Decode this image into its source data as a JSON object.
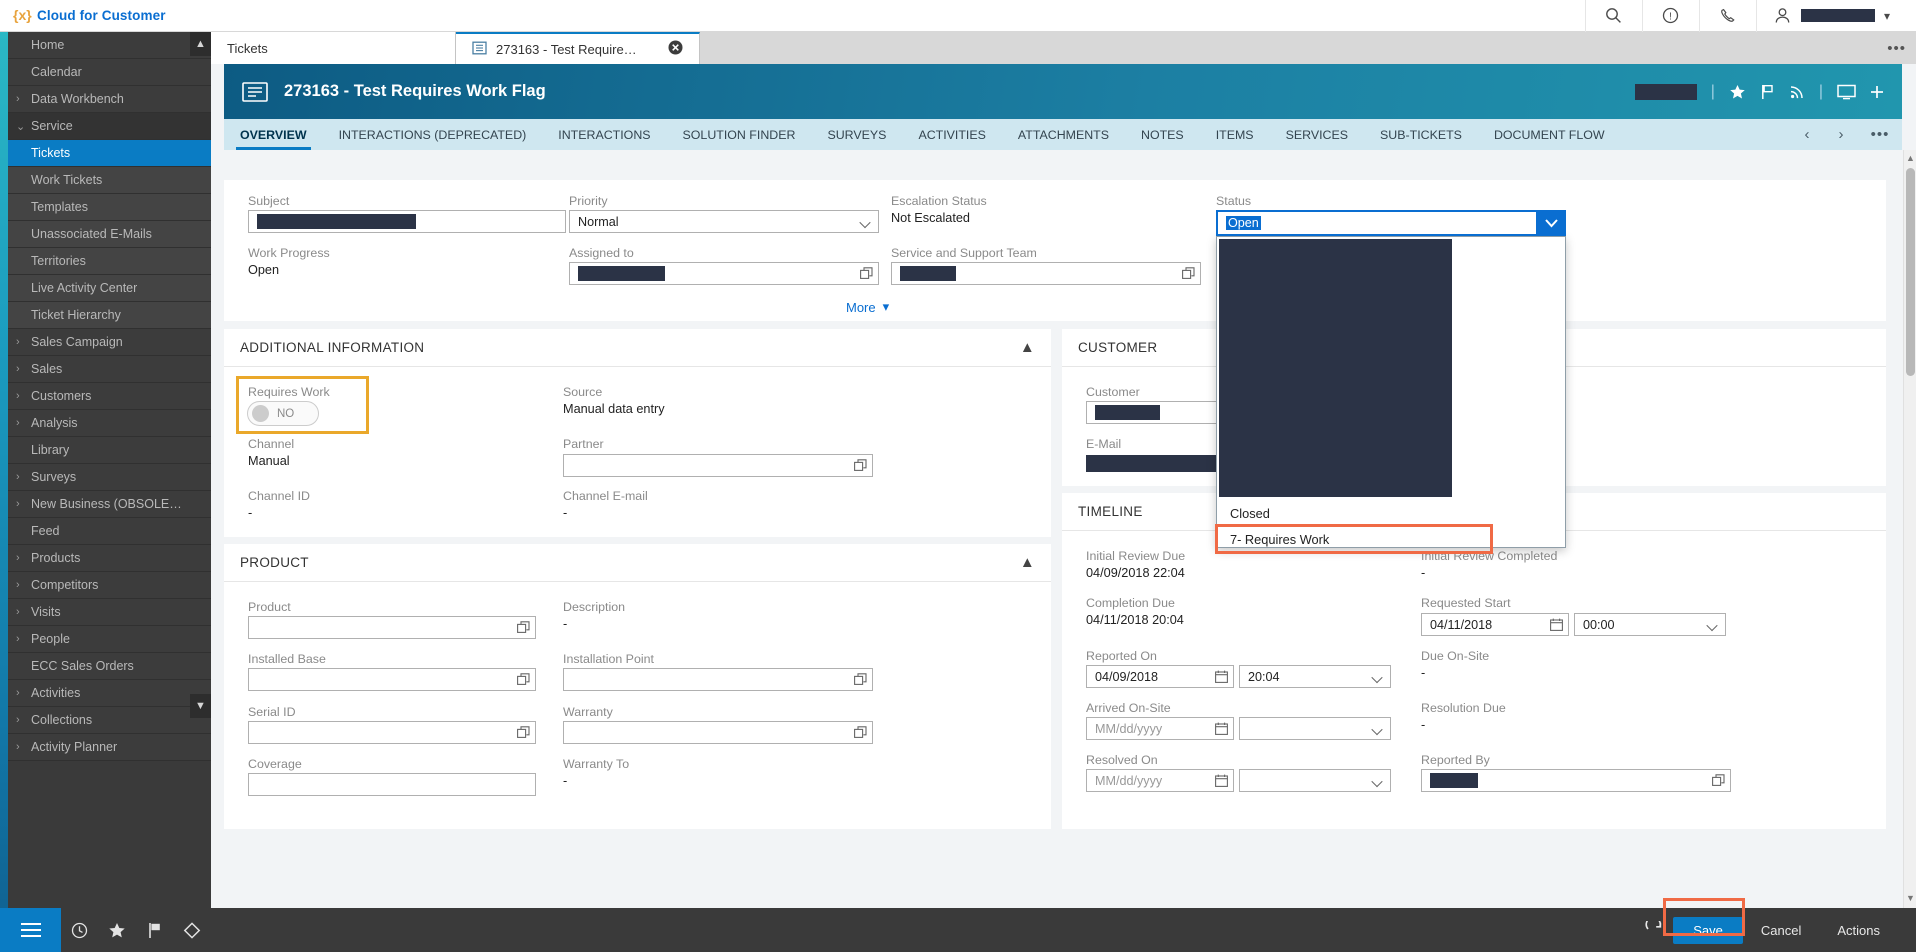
{
  "shell": {
    "product_title": "Cloud for Customer",
    "logo_glyph": "{x}",
    "icons": [
      "search-icon",
      "help-icon",
      "phone-icon",
      "user-icon"
    ],
    "user_redacted": true
  },
  "sidebar": {
    "items": [
      {
        "label": "Home",
        "arrow": "",
        "state": "normal"
      },
      {
        "label": "Calendar",
        "arrow": "",
        "state": "normal"
      },
      {
        "label": "Data Workbench",
        "arrow": "›",
        "state": "normal"
      },
      {
        "label": "Service",
        "arrow": "⌄",
        "state": "expanded"
      },
      {
        "label": "Tickets",
        "arrow": "",
        "state": "active"
      },
      {
        "label": "Work Tickets",
        "arrow": "",
        "state": "child"
      },
      {
        "label": "Templates",
        "arrow": "",
        "state": "child"
      },
      {
        "label": "Unassociated E-Mails",
        "arrow": "",
        "state": "child"
      },
      {
        "label": "Territories",
        "arrow": "",
        "state": "child"
      },
      {
        "label": "Live Activity Center",
        "arrow": "",
        "state": "child"
      },
      {
        "label": "Ticket Hierarchy",
        "arrow": "",
        "state": "child"
      },
      {
        "label": "Sales Campaign",
        "arrow": "›",
        "state": "normal"
      },
      {
        "label": "Sales",
        "arrow": "›",
        "state": "normal"
      },
      {
        "label": "Customers",
        "arrow": "›",
        "state": "normal"
      },
      {
        "label": "Analysis",
        "arrow": "›",
        "state": "normal"
      },
      {
        "label": "Library",
        "arrow": "",
        "state": "normal"
      },
      {
        "label": "Surveys",
        "arrow": "›",
        "state": "normal"
      },
      {
        "label": "New Business (OBSOLE…",
        "arrow": "›",
        "state": "normal"
      },
      {
        "label": "Feed",
        "arrow": "",
        "state": "normal"
      },
      {
        "label": "Products",
        "arrow": "›",
        "state": "normal"
      },
      {
        "label": "Competitors",
        "arrow": "›",
        "state": "normal"
      },
      {
        "label": "Visits",
        "arrow": "›",
        "state": "normal"
      },
      {
        "label": "People",
        "arrow": "›",
        "state": "normal"
      },
      {
        "label": "ECC Sales Orders",
        "arrow": "",
        "state": "normal"
      },
      {
        "label": "Activities",
        "arrow": "›",
        "state": "normal"
      },
      {
        "label": "Collections",
        "arrow": "›",
        "state": "normal"
      },
      {
        "label": "Activity Planner",
        "arrow": "›",
        "state": "normal"
      }
    ],
    "dock_icons": [
      "menu-icon",
      "recent-icon",
      "favorites-icon",
      "flag-icon",
      "tag-icon"
    ]
  },
  "worktabs": {
    "tabs": [
      {
        "label": "Tickets",
        "kind": "plain"
      },
      {
        "label": "273163 - Test Require…",
        "kind": "current"
      }
    ],
    "overflow_glyph": "•••"
  },
  "object_header": {
    "title": "273163 - Test Requires Work Flag",
    "icon": "ticket-icon",
    "redacted_field": true,
    "actions": [
      "favorite-icon",
      "flag-icon",
      "rss-icon",
      "screen-icon",
      "add-icon"
    ]
  },
  "detail_tabs": {
    "tabs": [
      {
        "label": "OVERVIEW",
        "selected": true
      },
      {
        "label": "INTERACTIONS (DEPRECATED)",
        "selected": false
      },
      {
        "label": "INTERACTIONS",
        "selected": false
      },
      {
        "label": "SOLUTION FINDER",
        "selected": false
      },
      {
        "label": "SURVEYS",
        "selected": false
      },
      {
        "label": "ACTIVITIES",
        "selected": false
      },
      {
        "label": "ATTACHMENTS",
        "selected": false
      },
      {
        "label": "NOTES",
        "selected": false
      },
      {
        "label": "ITEMS",
        "selected": false
      },
      {
        "label": "SERVICES",
        "selected": false
      },
      {
        "label": "SUB-TICKETS",
        "selected": false
      },
      {
        "label": "DOCUMENT FLOW",
        "selected": false
      }
    ],
    "prev_glyph": "‹",
    "next_glyph": "›",
    "more_glyph": "•••"
  },
  "general": {
    "subject_label": "Subject",
    "subject_value": "",
    "priority_label": "Priority",
    "priority_value": "Normal",
    "escalation_label": "Escalation Status",
    "escalation_value": "Not Escalated",
    "status_label": "Status",
    "status_value": "Open",
    "work_progress_label": "Work Progress",
    "work_progress_value": "Open",
    "assigned_label": "Assigned to",
    "assigned_value": "",
    "team_label": "Service and Support Team",
    "team_value": "",
    "more_label": "More"
  },
  "status_dropdown": {
    "open": true,
    "options": [
      {
        "label": "Closed",
        "highlighted": false
      },
      {
        "label": "7- Requires Work",
        "highlighted": true
      }
    ]
  },
  "additional_information": {
    "title": "ADDITIONAL INFORMATION",
    "requires_work_label": "Requires Work",
    "requires_work_value": "NO",
    "requires_work_highlighted": true,
    "source_label": "Source",
    "source_value": "Manual data entry",
    "channel_label": "Channel",
    "channel_value": "Manual",
    "partner_label": "Partner",
    "partner_value": "",
    "channel_id_label": "Channel ID",
    "channel_id_value": "-",
    "channel_email_label": "Channel E-mail",
    "channel_email_value": "-"
  },
  "product": {
    "title": "PRODUCT",
    "product_label": "Product",
    "product_value": "",
    "description_label": "Description",
    "description_value": "-",
    "installed_base_label": "Installed Base",
    "installed_base_value": "",
    "installation_point_label": "Installation Point",
    "installation_point_value": "",
    "serial_id_label": "Serial ID",
    "serial_id_value": "",
    "warranty_label": "Warranty",
    "warranty_value": "",
    "coverage_label": "Coverage",
    "coverage_value": "",
    "warranty_to_label": "Warranty To",
    "warranty_to_value": "-"
  },
  "customer": {
    "title": "CUSTOMER",
    "customer_label": "Customer",
    "customer_value": "",
    "email_label": "E-Mail",
    "email_value": ""
  },
  "timeline": {
    "title": "TIMELINE",
    "initial_review_due_label": "Initial Review Due",
    "initial_review_due_value": "04/09/2018 22:04",
    "initial_review_completed_label": "Initial Review Completed",
    "initial_review_completed_value": "-",
    "completion_due_label": "Completion Due",
    "completion_due_value": "04/11/2018 20:04",
    "requested_start_label": "Requested Start",
    "requested_start_date": "04/11/2018",
    "requested_start_time": "00:00",
    "reported_on_label": "Reported On",
    "reported_on_date": "04/09/2018",
    "reported_on_time": "20:04",
    "due_onsite_label": "Due On-Site",
    "due_onsite_value": "-",
    "arrived_onsite_label": "Arrived On-Site",
    "arrived_onsite_placeholder": "MM/dd/yyyy",
    "arrived_onsite_time": "",
    "resolution_due_label": "Resolution Due",
    "resolution_due_value": "-",
    "resolved_on_label": "Resolved On",
    "resolved_on_placeholder": "MM/dd/yyyy",
    "resolved_on_time": "",
    "reported_by_label": "Reported By",
    "reported_by_value": ""
  },
  "footer": {
    "save_label": "Save",
    "cancel_label": "Cancel",
    "actions_label": "Actions",
    "refresh_icon": "refresh-icon",
    "save_highlighted": true
  },
  "colors": {
    "brand_blue": "#0a7cc4",
    "link_blue": "#0a6ed1",
    "header_teal": "#1c7fa3",
    "highlight_yellow": "#eaa82a",
    "highlight_orange": "#f06a45",
    "nav_dark": "#3a3a3a",
    "redaction": "#2b3346"
  }
}
